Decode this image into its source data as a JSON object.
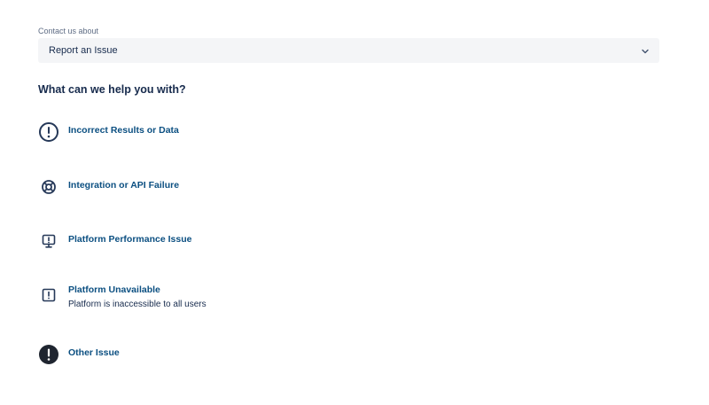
{
  "contact": {
    "label": "Contact us about",
    "selected_value": "Report an Issue"
  },
  "heading": "What can we help you with?",
  "options": [
    {
      "title": "Incorrect Results or Data",
      "icon": "error-circle-icon"
    },
    {
      "title": "Integration or API Failure",
      "icon": "lifebuoy-icon"
    },
    {
      "title": "Platform Performance Issue",
      "icon": "monitor-warning-icon"
    },
    {
      "title": "Platform Unavailable",
      "description": "Platform is inaccessible to all users",
      "icon": "square-warning-icon"
    },
    {
      "title": "Other Issue",
      "icon": "filled-warning-circle-icon"
    }
  ],
  "colors": {
    "link": "#0b4f81",
    "text": "#172b4d",
    "field_bg": "#f4f5f7"
  }
}
